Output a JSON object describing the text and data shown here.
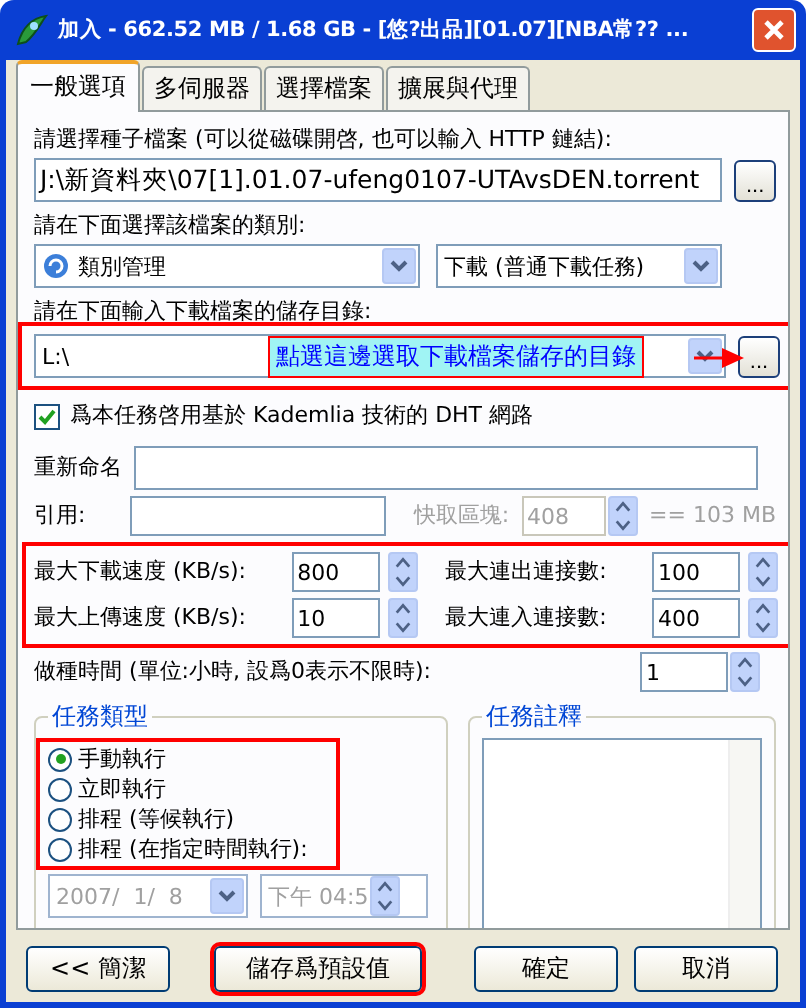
{
  "window": {
    "title": "加入 - 662.52 MB / 1.68 GB - [悠?出品][01.07][NBA常?? ..."
  },
  "tabs": [
    {
      "label": "一般選項",
      "selected": true
    },
    {
      "label": "多伺服器",
      "selected": false
    },
    {
      "label": "選擇檔案",
      "selected": false
    },
    {
      "label": "擴展與代理",
      "selected": false
    }
  ],
  "torrent": {
    "label": "請選擇種子檔案 (可以從磁碟開啓, 也可以輸入 HTTP 鏈結):",
    "value": "J:\\新資料夾\\07[1].01.07-ufeng0107-UTAvsDEN.torrent",
    "browse": "..."
  },
  "category": {
    "label": "請在下面選擇該檔案的類別:",
    "category": "類別管理",
    "mode": "下載 (普通下載任務)"
  },
  "directory": {
    "label": "請在下面輸入下載檔案的儲存目錄:",
    "value": "L:\\",
    "browse": "...",
    "highlighted": true,
    "callout": "點選這邊選取下載檔案儲存的目錄"
  },
  "dht": {
    "label": "爲本任務啓用基於 Kademlia 技術的 DHT 網路",
    "checked": true
  },
  "rename": {
    "label": "重新命名"
  },
  "reference": {
    "label": "引用:",
    "cache_label": "快取區塊:",
    "cache_value": "408",
    "cache_size": "== 103 MB",
    "disabled": true
  },
  "limits": {
    "highlighted": true,
    "items": [
      {
        "label": "最大下載速度 (KB/s):",
        "value": "800"
      },
      {
        "label": "最大連出連接數:",
        "value": "100"
      },
      {
        "label": "最大上傳速度 (KB/s):",
        "value": "10"
      },
      {
        "label": "最大連入連接數:",
        "value": "400"
      }
    ]
  },
  "seed_time": {
    "label": "做種時間 (單位:小時, 設爲0表示不限時):",
    "value": "1"
  },
  "task_type": {
    "title": "任務類型",
    "highlighted": true,
    "options": [
      {
        "label": "手動執行",
        "selected": true
      },
      {
        "label": "立即執行",
        "selected": false
      },
      {
        "label": "排程 (等候執行)",
        "selected": false
      },
      {
        "label": "排程 (在指定時間執行):",
        "selected": false
      }
    ],
    "date": "2007/  1/  8",
    "time": "下午 04:5",
    "disabled": true
  },
  "notes": {
    "title": "任務註釋"
  },
  "buttons": [
    {
      "label": "<< 簡潔",
      "highlighted": false
    },
    {
      "label": "儲存爲預設值",
      "highlighted": true
    },
    {
      "label": "確定",
      "highlighted": false
    },
    {
      "label": "取消",
      "highlighted": false
    }
  ]
}
